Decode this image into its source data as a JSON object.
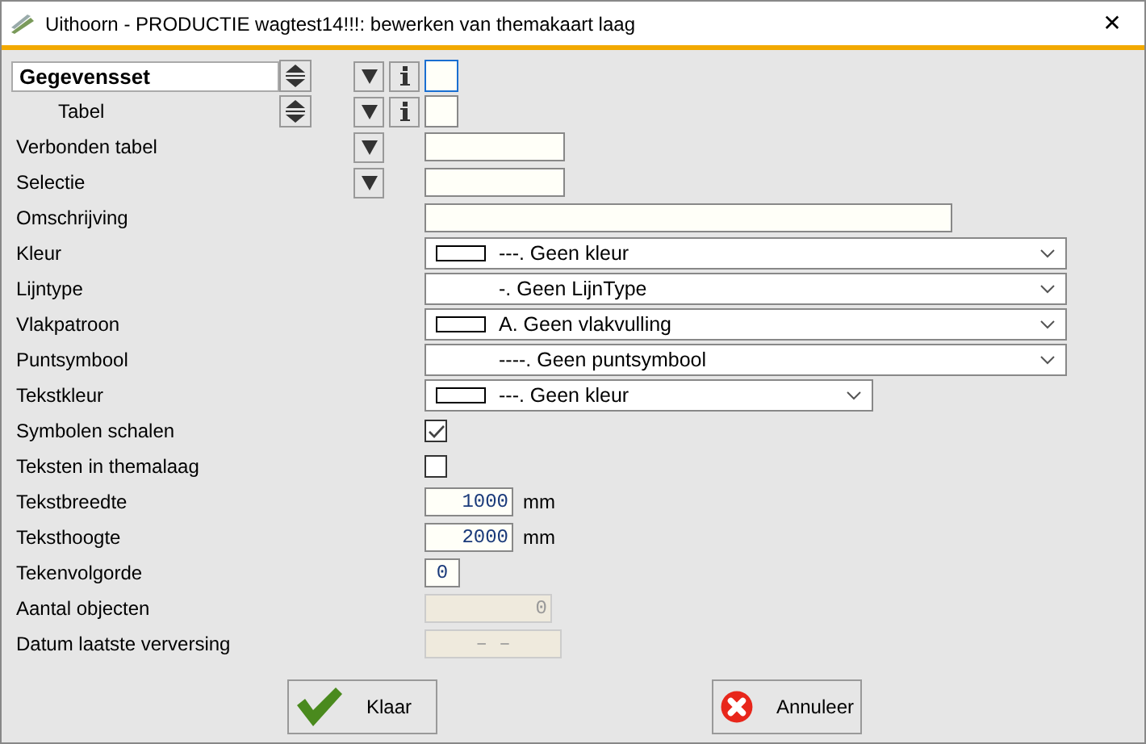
{
  "window": {
    "title": "Uithoorn - PRODUCTIE wagtest14!!!: bewerken van themakaart laag",
    "close": "✕"
  },
  "rows": [
    {
      "kind": "picker",
      "label": "Gegevensset",
      "primary": true,
      "focused": true
    },
    {
      "kind": "picker",
      "label": "Tabel",
      "primary": false,
      "focused": false
    },
    {
      "kind": "lookup",
      "label": "Verbonden tabel"
    },
    {
      "kind": "lookup",
      "label": "Selectie"
    },
    {
      "kind": "text",
      "label": "Omschrijving"
    },
    {
      "kind": "select",
      "label": "Kleur",
      "value": "---. Geen kleur",
      "swatch": true,
      "wide": true
    },
    {
      "kind": "select",
      "label": "Lijntype",
      "value": "-. Geen LijnType",
      "swatch": false,
      "wide": true
    },
    {
      "kind": "select",
      "label": "Vlakpatroon",
      "value": "A. Geen vlakvulling",
      "swatch": true,
      "wide": true
    },
    {
      "kind": "select",
      "label": "Puntsymbool",
      "value": "----. Geen puntsymbool",
      "swatch": false,
      "wide": true
    },
    {
      "kind": "select",
      "label": "Tekstkleur",
      "value": "---. Geen kleur",
      "swatch": true,
      "wide": false
    },
    {
      "kind": "check",
      "label": "Symbolen schalen",
      "checked": true
    },
    {
      "kind": "check",
      "label": "Teksten in themalaag",
      "checked": false
    },
    {
      "kind": "number",
      "label": "Tekstbreedte",
      "value": "1000",
      "unit": "mm"
    },
    {
      "kind": "number",
      "label": "Teksthoogte",
      "value": "2000",
      "unit": "mm"
    },
    {
      "kind": "small",
      "label": "Tekenvolgorde",
      "value": "0"
    },
    {
      "kind": "count",
      "label": "Aantal objecten",
      "value": "0",
      "disabled": true
    },
    {
      "kind": "date",
      "label": "Datum laatste verversing",
      "value": "–   –",
      "disabled": true
    }
  ],
  "buttons": [
    {
      "kind": "ok",
      "label": "Klaar"
    },
    {
      "kind": "cancel",
      "label": "Annuleer"
    }
  ]
}
